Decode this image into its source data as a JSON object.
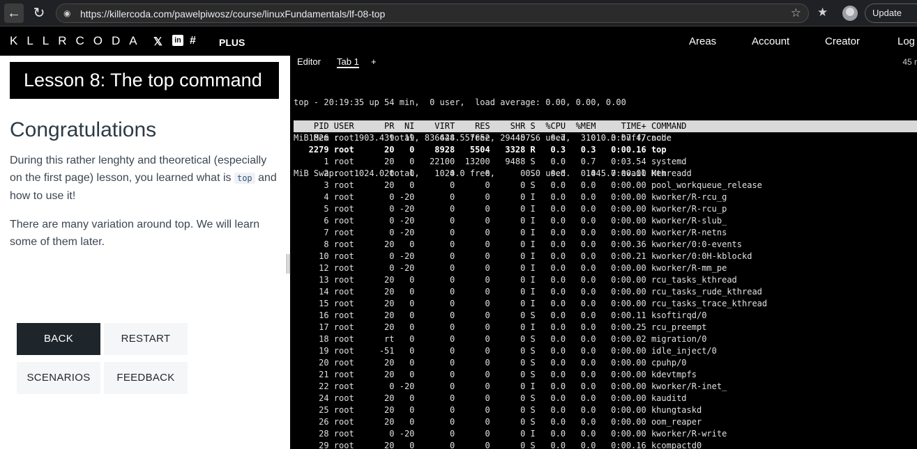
{
  "browser": {
    "url": "https://killercoda.com/pawelpiwosz/course/linuxFundamentals/lf-08-top",
    "update_label": "Update"
  },
  "site": {
    "logo": "KLLRCODA",
    "plus_label": "PLUS",
    "nav": [
      "Areas",
      "Account",
      "Creator",
      "Log"
    ]
  },
  "lesson": {
    "title": "Lesson 8: The top command",
    "heading": "Congratulations",
    "para1_before": "During this rather lenghty and theoretical (especially on the first page) lesson, you learned what is ",
    "para1_code": "top",
    "para1_after": " and how to use it!",
    "para2": "There are many variation around top. We will learn some of them later.",
    "buttons": {
      "back": "BACK",
      "restart": "RESTART",
      "scenarios": "SCENARIOS",
      "feedback": "FEEDBACK"
    }
  },
  "terminal": {
    "tabs": [
      "Editor",
      "Tab 1",
      "+"
    ],
    "tab_count": "45 r",
    "summary": [
      "top - 20:19:35 up 54 min,  0 user,  load average: 0.00, 0.00, 0.00",
      "MiB Mem :   1903.4 total,    628.5 free,    457.6 used,   1010.3 buff/cache",
      "MiB Swap:   1024.0 total,   1024.0 free,      0.0 used.   1445.7 avail Mem"
    ],
    "header": "    PID USER      PR  NI    VIRT    RES    SHR S  %CPU  %MEM     TIME+ COMMAND",
    "processes": [
      {
        "pid": "1826",
        "user": "root",
        "pr": "39",
        "ni": "19",
        "virt": "836444",
        "res": "57652",
        "shr": "29440",
        "s": "S",
        "cpu": "0.7",
        "mem": "3.0",
        "time": "0:07.47",
        "cmd": "node",
        "bold": false
      },
      {
        "pid": "2279",
        "user": "root",
        "pr": "20",
        "ni": "0",
        "virt": "8928",
        "res": "5504",
        "shr": "3328",
        "s": "R",
        "cpu": "0.3",
        "mem": "0.3",
        "time": "0:00.16",
        "cmd": "top",
        "bold": true
      },
      {
        "pid": "1",
        "user": "root",
        "pr": "20",
        "ni": "0",
        "virt": "22100",
        "res": "13200",
        "shr": "9488",
        "s": "S",
        "cpu": "0.0",
        "mem": "0.7",
        "time": "0:03.54",
        "cmd": "systemd",
        "bold": false
      },
      {
        "pid": "2",
        "user": "root",
        "pr": "20",
        "ni": "0",
        "virt": "0",
        "res": "0",
        "shr": "0",
        "s": "S",
        "cpu": "0.0",
        "mem": "0.0",
        "time": "0:00.00",
        "cmd": "kthreadd",
        "bold": false
      },
      {
        "pid": "3",
        "user": "root",
        "pr": "20",
        "ni": "0",
        "virt": "0",
        "res": "0",
        "shr": "0",
        "s": "S",
        "cpu": "0.0",
        "mem": "0.0",
        "time": "0:00.00",
        "cmd": "pool_workqueue_release",
        "bold": false
      },
      {
        "pid": "4",
        "user": "root",
        "pr": "0",
        "ni": "-20",
        "virt": "0",
        "res": "0",
        "shr": "0",
        "s": "I",
        "cpu": "0.0",
        "mem": "0.0",
        "time": "0:00.00",
        "cmd": "kworker/R-rcu_g",
        "bold": false
      },
      {
        "pid": "5",
        "user": "root",
        "pr": "0",
        "ni": "-20",
        "virt": "0",
        "res": "0",
        "shr": "0",
        "s": "I",
        "cpu": "0.0",
        "mem": "0.0",
        "time": "0:00.00",
        "cmd": "kworker/R-rcu_p",
        "bold": false
      },
      {
        "pid": "6",
        "user": "root",
        "pr": "0",
        "ni": "-20",
        "virt": "0",
        "res": "0",
        "shr": "0",
        "s": "I",
        "cpu": "0.0",
        "mem": "0.0",
        "time": "0:00.00",
        "cmd": "kworker/R-slub_",
        "bold": false
      },
      {
        "pid": "7",
        "user": "root",
        "pr": "0",
        "ni": "-20",
        "virt": "0",
        "res": "0",
        "shr": "0",
        "s": "I",
        "cpu": "0.0",
        "mem": "0.0",
        "time": "0:00.00",
        "cmd": "kworker/R-netns",
        "bold": false
      },
      {
        "pid": "8",
        "user": "root",
        "pr": "20",
        "ni": "0",
        "virt": "0",
        "res": "0",
        "shr": "0",
        "s": "I",
        "cpu": "0.0",
        "mem": "0.0",
        "time": "0:00.36",
        "cmd": "kworker/0:0-events",
        "bold": false
      },
      {
        "pid": "10",
        "user": "root",
        "pr": "0",
        "ni": "-20",
        "virt": "0",
        "res": "0",
        "shr": "0",
        "s": "I",
        "cpu": "0.0",
        "mem": "0.0",
        "time": "0:00.21",
        "cmd": "kworker/0:0H-kblockd",
        "bold": false
      },
      {
        "pid": "12",
        "user": "root",
        "pr": "0",
        "ni": "-20",
        "virt": "0",
        "res": "0",
        "shr": "0",
        "s": "I",
        "cpu": "0.0",
        "mem": "0.0",
        "time": "0:00.00",
        "cmd": "kworker/R-mm_pe",
        "bold": false
      },
      {
        "pid": "13",
        "user": "root",
        "pr": "20",
        "ni": "0",
        "virt": "0",
        "res": "0",
        "shr": "0",
        "s": "I",
        "cpu": "0.0",
        "mem": "0.0",
        "time": "0:00.00",
        "cmd": "rcu_tasks_kthread",
        "bold": false
      },
      {
        "pid": "14",
        "user": "root",
        "pr": "20",
        "ni": "0",
        "virt": "0",
        "res": "0",
        "shr": "0",
        "s": "I",
        "cpu": "0.0",
        "mem": "0.0",
        "time": "0:00.00",
        "cmd": "rcu_tasks_rude_kthread",
        "bold": false
      },
      {
        "pid": "15",
        "user": "root",
        "pr": "20",
        "ni": "0",
        "virt": "0",
        "res": "0",
        "shr": "0",
        "s": "I",
        "cpu": "0.0",
        "mem": "0.0",
        "time": "0:00.00",
        "cmd": "rcu_tasks_trace_kthread",
        "bold": false
      },
      {
        "pid": "16",
        "user": "root",
        "pr": "20",
        "ni": "0",
        "virt": "0",
        "res": "0",
        "shr": "0",
        "s": "S",
        "cpu": "0.0",
        "mem": "0.0",
        "time": "0:00.11",
        "cmd": "ksoftirqd/0",
        "bold": false
      },
      {
        "pid": "17",
        "user": "root",
        "pr": "20",
        "ni": "0",
        "virt": "0",
        "res": "0",
        "shr": "0",
        "s": "I",
        "cpu": "0.0",
        "mem": "0.0",
        "time": "0:00.25",
        "cmd": "rcu_preempt",
        "bold": false
      },
      {
        "pid": "18",
        "user": "root",
        "pr": "rt",
        "ni": "0",
        "virt": "0",
        "res": "0",
        "shr": "0",
        "s": "S",
        "cpu": "0.0",
        "mem": "0.0",
        "time": "0:00.02",
        "cmd": "migration/0",
        "bold": false
      },
      {
        "pid": "19",
        "user": "root",
        "pr": "-51",
        "ni": "0",
        "virt": "0",
        "res": "0",
        "shr": "0",
        "s": "S",
        "cpu": "0.0",
        "mem": "0.0",
        "time": "0:00.00",
        "cmd": "idle_inject/0",
        "bold": false
      },
      {
        "pid": "20",
        "user": "root",
        "pr": "20",
        "ni": "0",
        "virt": "0",
        "res": "0",
        "shr": "0",
        "s": "S",
        "cpu": "0.0",
        "mem": "0.0",
        "time": "0:00.00",
        "cmd": "cpuhp/0",
        "bold": false
      },
      {
        "pid": "21",
        "user": "root",
        "pr": "20",
        "ni": "0",
        "virt": "0",
        "res": "0",
        "shr": "0",
        "s": "S",
        "cpu": "0.0",
        "mem": "0.0",
        "time": "0:00.00",
        "cmd": "kdevtmpfs",
        "bold": false
      },
      {
        "pid": "22",
        "user": "root",
        "pr": "0",
        "ni": "-20",
        "virt": "0",
        "res": "0",
        "shr": "0",
        "s": "I",
        "cpu": "0.0",
        "mem": "0.0",
        "time": "0:00.00",
        "cmd": "kworker/R-inet_",
        "bold": false
      },
      {
        "pid": "24",
        "user": "root",
        "pr": "20",
        "ni": "0",
        "virt": "0",
        "res": "0",
        "shr": "0",
        "s": "S",
        "cpu": "0.0",
        "mem": "0.0",
        "time": "0:00.00",
        "cmd": "kauditd",
        "bold": false
      },
      {
        "pid": "25",
        "user": "root",
        "pr": "20",
        "ni": "0",
        "virt": "0",
        "res": "0",
        "shr": "0",
        "s": "S",
        "cpu": "0.0",
        "mem": "0.0",
        "time": "0:00.00",
        "cmd": "khungtaskd",
        "bold": false
      },
      {
        "pid": "26",
        "user": "root",
        "pr": "20",
        "ni": "0",
        "virt": "0",
        "res": "0",
        "shr": "0",
        "s": "S",
        "cpu": "0.0",
        "mem": "0.0",
        "time": "0:00.00",
        "cmd": "oom_reaper",
        "bold": false
      },
      {
        "pid": "28",
        "user": "root",
        "pr": "0",
        "ni": "-20",
        "virt": "0",
        "res": "0",
        "shr": "0",
        "s": "I",
        "cpu": "0.0",
        "mem": "0.0",
        "time": "0:00.00",
        "cmd": "kworker/R-write",
        "bold": false
      },
      {
        "pid": "29",
        "user": "root",
        "pr": "20",
        "ni": "0",
        "virt": "0",
        "res": "0",
        "shr": "0",
        "s": "S",
        "cpu": "0.0",
        "mem": "0.0",
        "time": "0:00.16",
        "cmd": "kcompactd0",
        "bold": false
      }
    ]
  },
  "icons": {
    "back": "arrow-left",
    "reload": "reload",
    "lock": "lock",
    "star": "star",
    "favorites": "favorites",
    "profile": "user-avatar",
    "x": "x-logo",
    "linkedin": "linkedin-logo",
    "slack": "slack-logo"
  }
}
